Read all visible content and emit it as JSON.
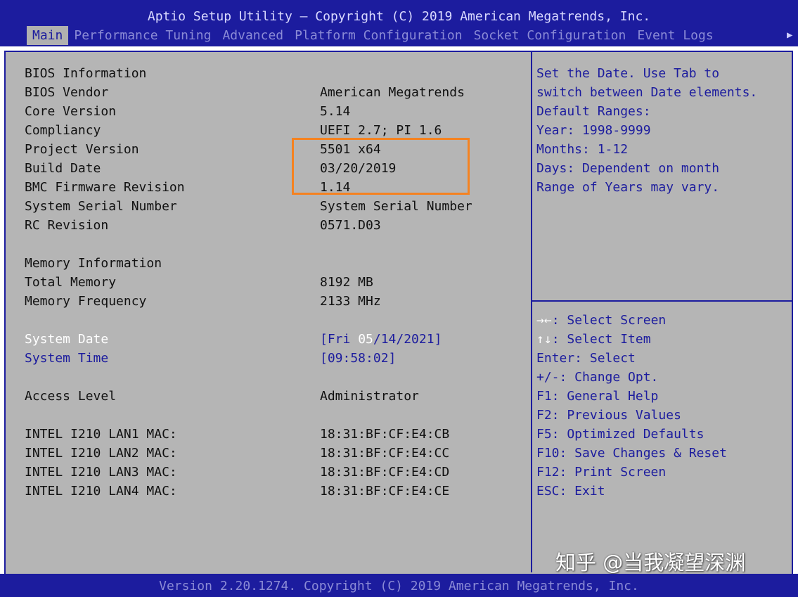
{
  "title": "Aptio Setup Utility – Copyright (C) 2019 American Megatrends, Inc.",
  "tabs": [
    {
      "label": "Main",
      "active": true
    },
    {
      "label": "Performance Tuning"
    },
    {
      "label": "Advanced"
    },
    {
      "label": "Platform Configuration"
    },
    {
      "label": "Socket Configuration"
    },
    {
      "label": "Event Logs"
    }
  ],
  "tab_scroll_icon": "right-triangle-icon",
  "main": {
    "bios_info_header": "BIOS Information",
    "bios_vendor": {
      "label": "BIOS Vendor",
      "value": "American Megatrends"
    },
    "core_version": {
      "label": "Core Version",
      "value": "5.14"
    },
    "compliancy": {
      "label": "Compliancy",
      "value": "UEFI 2.7; PI 1.6"
    },
    "project_version": {
      "label": "Project Version",
      "value": "5501 x64"
    },
    "build_date": {
      "label": "Build Date",
      "value": "03/20/2019"
    },
    "bmc_firmware": {
      "label": "BMC Firmware Revision",
      "value": "1.14"
    },
    "system_serial": {
      "label": "System Serial Number",
      "value": "System Serial Number"
    },
    "rc_revision": {
      "label": "RC Revision",
      "value": "0571.D03"
    },
    "memory_info_header": "Memory Information",
    "total_memory": {
      "label": "Total Memory",
      "value": "8192 MB"
    },
    "memory_frequency": {
      "label": "Memory Frequency",
      "value": "2133 MHz"
    },
    "system_date": {
      "label": "System Date",
      "value_prefix": "[Fri ",
      "value_month": "05",
      "value_suffix": "/14/2021]"
    },
    "system_time": {
      "label": "System Time",
      "value": "[09:58:02]"
    },
    "access_level": {
      "label": "Access Level",
      "value": "Administrator"
    },
    "lan1": {
      "label": "INTEL I210 LAN1 MAC:",
      "value": "18:31:BF:CF:E4:CB"
    },
    "lan2": {
      "label": "INTEL I210 LAN2 MAC:",
      "value": "18:31:BF:CF:E4:CC"
    },
    "lan3": {
      "label": "INTEL I210 LAN3 MAC:",
      "value": "18:31:BF:CF:E4:CD"
    },
    "lan4": {
      "label": "INTEL I210 LAN4 MAC:",
      "value": "18:31:BF:CF:E4:CE"
    }
  },
  "help": {
    "lines": [
      "Set the Date. Use Tab to",
      "switch between Date elements.",
      "Default Ranges:",
      "Year: 1998-9999",
      "Months: 1-12",
      "Days: Dependent on month",
      "Range of Years may vary."
    ]
  },
  "keys": [
    {
      "key": "→←",
      "desc": ": Select Screen"
    },
    {
      "key": "↑↓",
      "desc": ": Select Item"
    },
    {
      "text": "Enter: Select"
    },
    {
      "text": "+/-: Change Opt."
    },
    {
      "text": "F1: General Help"
    },
    {
      "text": "F2: Previous Values"
    },
    {
      "text": "F5: Optimized Defaults"
    },
    {
      "text": "F10: Save Changes & Reset"
    },
    {
      "text": "F12: Print Screen"
    },
    {
      "text": "ESC: Exit"
    }
  ],
  "footer": "Version 2.20.1274. Copyright (C) 2019 American Megatrends, Inc.",
  "watermark": "知乎 @当我凝望深渊",
  "colors": {
    "bios_blue": "#1c1c9e",
    "panel_gray": "#b5b5b5",
    "highlight_orange": "#f58220"
  }
}
